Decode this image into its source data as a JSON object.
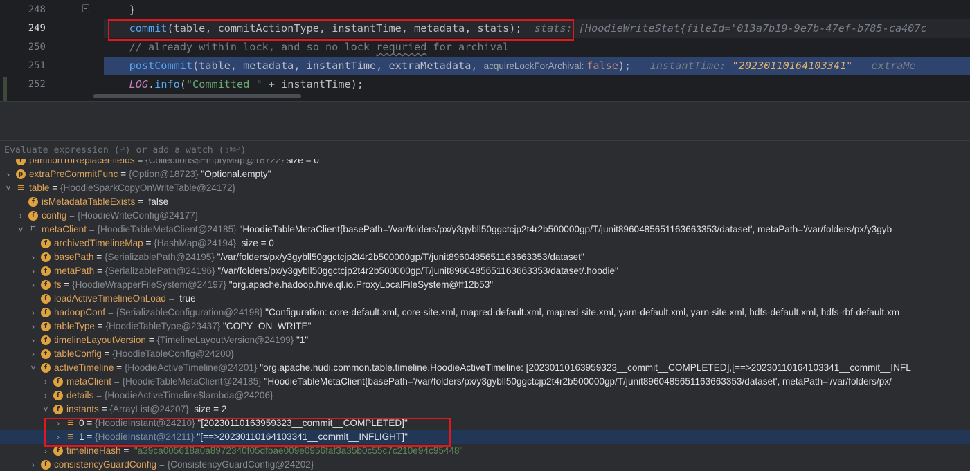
{
  "editor": {
    "lines": [
      {
        "num": "248",
        "tokens": [
          {
            "t": "    }",
            "c": ""
          }
        ]
      },
      {
        "num": "249",
        "tokens": [
          {
            "t": "    ",
            "c": ""
          },
          {
            "t": "commit",
            "c": "k-method"
          },
          {
            "t": "(table, commitActionType, instantTime, metadata, stats);",
            "c": ""
          },
          {
            "t": "  stats: [HoodieWriteStat{fileId='013a7b19-9e7b-47ef-b785-ca407c",
            "c": "k-inlay-name"
          }
        ]
      },
      {
        "num": "250",
        "tokens": [
          {
            "t": "    // already within lock, and so no lock ",
            "c": "k-comment"
          },
          {
            "t": "requried",
            "c": "k-comment typo"
          },
          {
            "t": " for archival",
            "c": "k-comment"
          }
        ]
      },
      {
        "num": "251",
        "tokens": [
          {
            "t": "    ",
            "c": ""
          },
          {
            "t": "postCommit",
            "c": "k-method"
          },
          {
            "t": "(table, metadata, instantTime, extraMetadata, ",
            "c": ""
          },
          {
            "t": "acquireLockForArchival: ",
            "c": "k-hint"
          },
          {
            "t": "false",
            "c": "k-keyword"
          },
          {
            "t": ");   ",
            "c": ""
          },
          {
            "t": "instantTime: ",
            "c": "k-inlay-name"
          },
          {
            "t": "\"20230110164103341\"",
            "c": "k-inlay-val"
          },
          {
            "t": "   extraMe",
            "c": "k-inlay-name"
          }
        ]
      },
      {
        "num": "252",
        "tokens": [
          {
            "t": "    ",
            "c": ""
          },
          {
            "t": "LOG",
            "c": "k-static"
          },
          {
            "t": ".",
            "c": ""
          },
          {
            "t": "info",
            "c": "k-method"
          },
          {
            "t": "(",
            "c": ""
          },
          {
            "t": "\"Committed \"",
            "c": "k-string"
          },
          {
            "t": " + instantTime);",
            "c": ""
          }
        ]
      }
    ]
  },
  "evaluate": {
    "placeholder": "Evaluate expression (⏎) or add a watch (⇧⌘⏎)"
  },
  "variables": [
    {
      "indent": 0,
      "arrow": "",
      "icon": "field",
      "name": "partitionToReplaceFileIds",
      "type": "{Collections$EmptyMap@18722}",
      "value": " size = 0",
      "partial": true
    },
    {
      "indent": 0,
      "arrow": "›",
      "icon": "protected",
      "name": "extraPreCommitFunc",
      "type": "{Option@18723}",
      "value": " \"Optional.empty\""
    },
    {
      "indent": 0,
      "arrow": "⌵",
      "icon": "arr",
      "name": "table",
      "type": "{HoodieSparkCopyOnWriteTable@24172}",
      "value": ""
    },
    {
      "indent": 1,
      "arrow": "",
      "icon": "field",
      "name": "isMetadataTableExists",
      "type": "",
      "value": " false"
    },
    {
      "indent": 1,
      "arrow": "›",
      "icon": "lock",
      "name": "config",
      "type": "{HoodieWriteConfig@24177}",
      "value": ""
    },
    {
      "indent": 1,
      "arrow": "⌵",
      "icon": "iface",
      "name": "metaClient",
      "type": "{HoodieTableMetaClient@24185}",
      "value": " \"HoodieTableMetaClient{basePath='/var/folders/px/y3gybll50ggctcjp2t4r2b500000gp/T/junit8960485651163663353/dataset', metaPath='/var/folders/px/y3gyb"
    },
    {
      "indent": 2,
      "arrow": "",
      "icon": "lock",
      "name": "archivedTimelineMap",
      "type": "{HashMap@24194}",
      "value": "  size = 0"
    },
    {
      "indent": 2,
      "arrow": "›",
      "icon": "field",
      "name": "basePath",
      "type": "{SerializablePath@24195}",
      "value": " \"/var/folders/px/y3gybll50ggctcjp2t4r2b500000gp/T/junit8960485651163663353/dataset\""
    },
    {
      "indent": 2,
      "arrow": "›",
      "icon": "field",
      "name": "metaPath",
      "type": "{SerializablePath@24196}",
      "value": " \"/var/folders/px/y3gybll50ggctcjp2t4r2b500000gp/T/junit8960485651163663353/dataset/.hoodie\""
    },
    {
      "indent": 2,
      "arrow": "›",
      "icon": "field",
      "name": "fs",
      "type": "{HoodieWrapperFileSystem@24197}",
      "value": " \"org.apache.hadoop.hive.ql.io.ProxyLocalFileSystem@ff12b53\""
    },
    {
      "indent": 2,
      "arrow": "",
      "icon": "field",
      "name": "loadActiveTimelineOnLoad",
      "type": "",
      "value": " true"
    },
    {
      "indent": 2,
      "arrow": "›",
      "icon": "field",
      "name": "hadoopConf",
      "type": "{SerializableConfiguration@24198}",
      "value": " \"Configuration: core-default.xml, core-site.xml, mapred-default.xml, mapred-site.xml, yarn-default.xml, yarn-site.xml, hdfs-default.xml, hdfs-rbf-default.xm"
    },
    {
      "indent": 2,
      "arrow": "›",
      "icon": "field",
      "name": "tableType",
      "type": "{HoodieTableType@23437}",
      "value": " \"COPY_ON_WRITE\""
    },
    {
      "indent": 2,
      "arrow": "›",
      "icon": "field",
      "name": "timelineLayoutVersion",
      "type": "{TimelineLayoutVersion@24199}",
      "value": " \"1\""
    },
    {
      "indent": 2,
      "arrow": "›",
      "icon": "field",
      "name": "tableConfig",
      "type": "{HoodieTableConfig@24200}",
      "value": ""
    },
    {
      "indent": 2,
      "arrow": "⌵",
      "icon": "field",
      "name": "activeTimeline",
      "type": "{HoodieActiveTimeline@24201}",
      "value": " \"org.apache.hudi.common.table.timeline.HoodieActiveTimeline: [20230110163959323__commit__COMPLETED],[==>20230110164103341__commit__INFL"
    },
    {
      "indent": 3,
      "arrow": "›",
      "icon": "field",
      "name": "metaClient",
      "type": "{HoodieTableMetaClient@24185}",
      "value": " \"HoodieTableMetaClient{basePath='/var/folders/px/y3gybll50ggctcjp2t4r2b500000gp/T/junit8960485651163663353/dataset', metaPath='/var/folders/px/"
    },
    {
      "indent": 3,
      "arrow": "›",
      "icon": "field",
      "name": "details",
      "type": "{HoodieActiveTimeline$lambda@24206}",
      "value": ""
    },
    {
      "indent": 3,
      "arrow": "⌵",
      "icon": "field",
      "name": "instants",
      "type": "{ArrayList@24207}",
      "value": "  size = 2"
    },
    {
      "indent": 4,
      "arrow": "›",
      "icon": "arr",
      "name": "0",
      "type": "{HoodieInstant@24210}",
      "value": " \"[20230110163959323__commit__COMPLETED]\"",
      "plainName": true
    },
    {
      "indent": 4,
      "arrow": "›",
      "icon": "arr",
      "name": "1",
      "type": "{HoodieInstant@24211}",
      "value": " \"[==>20230110164103341__commit__INFLIGHT]\"",
      "plainName": true,
      "selected": true
    },
    {
      "indent": 3,
      "arrow": "›",
      "icon": "field",
      "name": "timelineHash",
      "type": "",
      "value": " \"a39ca005618a0a8972340f05dfbae009e0956faf3a35b0c55c7c210e94c95448\"",
      "strValue": true
    },
    {
      "indent": 2,
      "arrow": "›",
      "icon": "field",
      "name": "consistencyGuardConfig",
      "type": "{ConsistencyGuardConfig@24202}",
      "value": ""
    }
  ]
}
